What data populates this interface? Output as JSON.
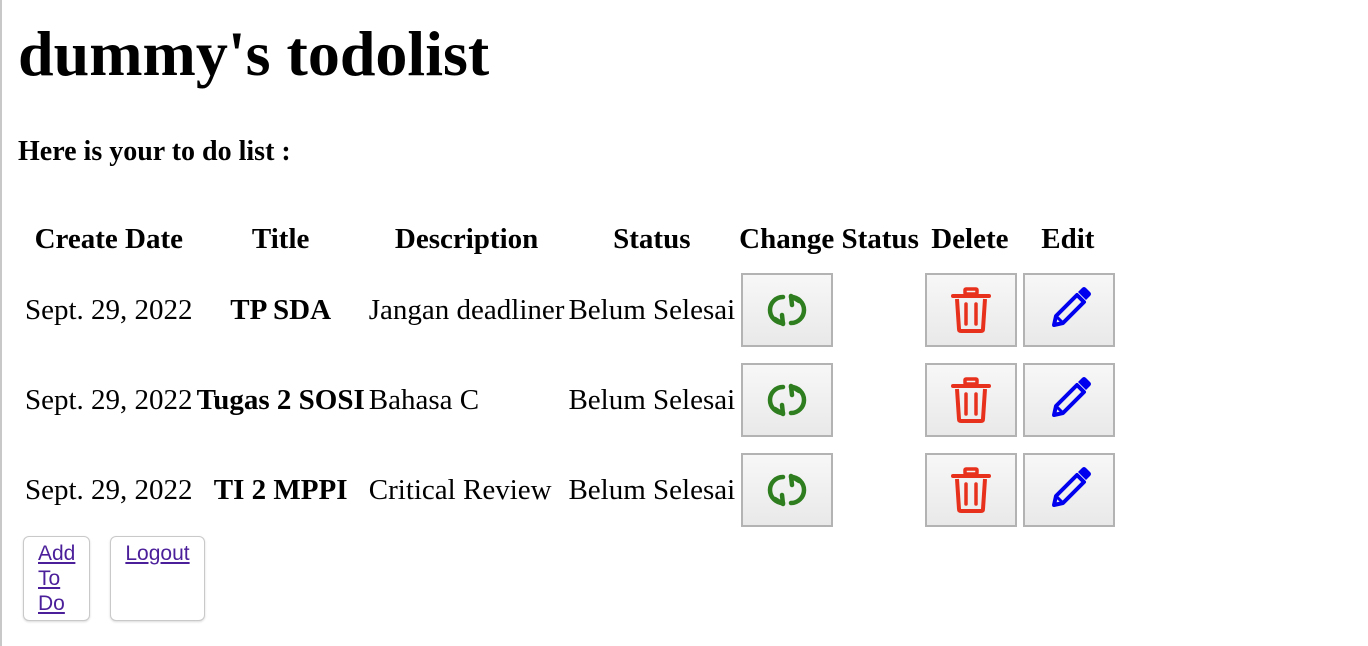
{
  "page": {
    "title": "dummy's todolist",
    "subtitle": "Here is your to do list :"
  },
  "table": {
    "headers": {
      "create_date": "Create Date",
      "title": "Title",
      "description": "Description",
      "status": "Status",
      "change_status": "Change Status",
      "delete": "Delete",
      "edit": "Edit"
    },
    "rows": [
      {
        "create_date": "Sept. 29, 2022",
        "title": "TP SDA",
        "description": "Jangan deadliner",
        "status": "Belum Selesai"
      },
      {
        "create_date": "Sept. 29, 2022",
        "title": "Tugas 2 SOSI",
        "description": "Bahasa C",
        "status": "Belum Selesai"
      },
      {
        "create_date": "Sept. 29, 2022",
        "title": "TI 2 MPPI",
        "description": "Critical Review",
        "status": "Belum Selesai"
      }
    ]
  },
  "actions": {
    "add_todo_label": "Add To Do",
    "logout_label": "Logout"
  },
  "icons": {
    "change_status": "refresh-icon",
    "delete": "trash-icon",
    "edit": "pencil-icon"
  },
  "colors": {
    "refresh": "#2e7d1f",
    "trash": "#e8311c",
    "pencil": "#0000ee",
    "link": "#4b1f9a"
  }
}
